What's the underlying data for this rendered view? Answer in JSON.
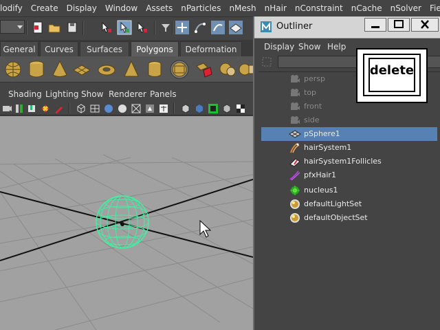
{
  "main_menu": [
    "lodify",
    "Create",
    "Display",
    "Window",
    "Assets",
    "nParticles",
    "nMesh",
    "nHair",
    "nConstraint",
    "nCache",
    "nSolver",
    "Fields"
  ],
  "shelf_tabs": [
    "General",
    "Curves",
    "Surfaces",
    "Polygons",
    "Deformation"
  ],
  "active_shelf_tab": "Polygons",
  "panel_menu": [
    "Shading",
    "Lighting",
    "Show",
    "Renderer",
    "Panels"
  ],
  "outliner": {
    "title": "Outliner",
    "menu": [
      "Display",
      "Show",
      "Help"
    ],
    "items": [
      {
        "label": "persp",
        "icon": "camera-icon",
        "dim": true,
        "selected": false
      },
      {
        "label": "top",
        "icon": "camera-icon",
        "dim": true,
        "selected": false
      },
      {
        "label": "front",
        "icon": "camera-icon",
        "dim": true,
        "selected": false
      },
      {
        "label": "side",
        "icon": "camera-icon",
        "dim": true,
        "selected": false
      },
      {
        "label": "pSphere1",
        "icon": "mesh-icon",
        "dim": false,
        "selected": true
      },
      {
        "label": "hairSystem1",
        "icon": "hair-system-icon",
        "dim": false,
        "selected": false
      },
      {
        "label": "hairSystem1Follicles",
        "icon": "follicles-icon",
        "dim": false,
        "selected": false
      },
      {
        "label": "pfxHair1",
        "icon": "pfx-hair-icon",
        "dim": false,
        "selected": false
      },
      {
        "label": "nucleus1",
        "icon": "nucleus-icon",
        "dim": false,
        "selected": false
      },
      {
        "label": "defaultLightSet",
        "icon": "set-icon",
        "dim": false,
        "selected": false
      },
      {
        "label": "defaultObjectSet",
        "icon": "set-icon",
        "dim": false,
        "selected": false
      }
    ]
  },
  "delete_key_overlay": "delete",
  "colors": {
    "selection": "#5881b3",
    "sphere_wireframe": "#3ff0a0",
    "viewport_bg": "#a1a1a1"
  }
}
